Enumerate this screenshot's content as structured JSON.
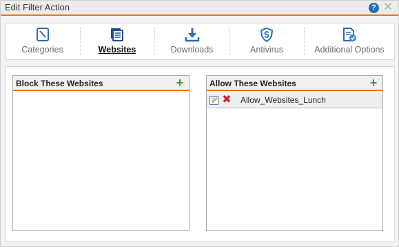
{
  "dialog": {
    "title": "Edit Filter Action",
    "help_label": "?",
    "close_label": "✕"
  },
  "tabs": [
    {
      "label": "Categories",
      "icon": "categories-icon",
      "active": false
    },
    {
      "label": "Websites",
      "icon": "websites-icon",
      "active": true
    },
    {
      "label": "Downloads",
      "icon": "download-icon",
      "active": false
    },
    {
      "label": "Antivirus",
      "icon": "antivirus-icon",
      "active": false
    },
    {
      "label": "Additional Options",
      "icon": "additional-options-icon",
      "active": false
    }
  ],
  "panels": {
    "block": {
      "title": "Block These Websites",
      "add_label": "+",
      "rows": []
    },
    "allow": {
      "title": "Allow These Websites",
      "add_label": "+",
      "rows": [
        {
          "name": "Allow_Websites_Lunch",
          "delete_label": "✖"
        }
      ]
    }
  },
  "colors": {
    "accent_orange": "#e07a1f",
    "icon_blue": "#1e6fb8",
    "add_green": "#3f9a2a",
    "delete_red": "#d42020"
  }
}
